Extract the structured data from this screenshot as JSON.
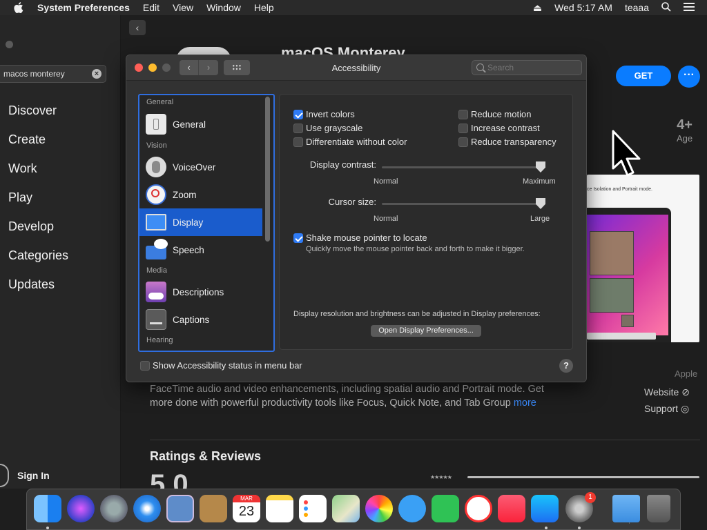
{
  "menubar": {
    "app_name": "System Preferences",
    "items": [
      "Edit",
      "View",
      "Window",
      "Help"
    ],
    "clock": "Wed 5:17 AM",
    "user": "teaaa"
  },
  "store": {
    "search_value": "macos monterey",
    "nav": [
      "Discover",
      "Create",
      "Work",
      "Play",
      "Develop",
      "Categories",
      "Updates"
    ],
    "sign_in": "Sign In",
    "app_title": "macOS Monterey",
    "get_label": "GET",
    "more_label": "···",
    "age_rating": "4+",
    "age_label": "Age",
    "preview_caption": "ce Isolation and Portrait mode.",
    "description_line1": "FaceTime audio and video enhancements, including spatial audio and Portrait mode. Get",
    "description_line2": "more done with powerful productivity tools like Focus, Quick Note, and Tab Group",
    "more_link": "more",
    "developer": "Apple",
    "website": "Website",
    "support": "Support",
    "ratings_title": "Ratings & Reviews",
    "rating_value": "5.0",
    "stars": "★★★★★"
  },
  "window": {
    "title": "Accessibility",
    "search_placeholder": "Search",
    "sidebar": {
      "sections": [
        "General",
        "Vision",
        "Media",
        "Hearing"
      ],
      "items": [
        "General",
        "VoiceOver",
        "Zoom",
        "Display",
        "Speech",
        "Descriptions",
        "Captions"
      ],
      "selected": "Display"
    },
    "options": {
      "invert_colors": "Invert colors",
      "use_grayscale": "Use grayscale",
      "differentiate": "Differentiate without color",
      "reduce_motion": "Reduce motion",
      "increase_contrast": "Increase contrast",
      "reduce_transparency": "Reduce transparency"
    },
    "checked": {
      "invert_colors": true,
      "use_grayscale": false,
      "differentiate": false,
      "reduce_motion": false,
      "increase_contrast": false,
      "reduce_transparency": false,
      "shake": true,
      "status_menu": false
    },
    "display_contrast": {
      "label": "Display contrast:",
      "min": "Normal",
      "max": "Maximum",
      "value": 1.0
    },
    "cursor_size": {
      "label": "Cursor size:",
      "min": "Normal",
      "max": "Large",
      "value": 1.0
    },
    "shake": {
      "label": "Shake mouse pointer to locate",
      "hint": "Quickly move the mouse pointer back and forth to make it bigger."
    },
    "display_note": "Display resolution and brightness can be adjusted in Display preferences:",
    "open_display_button": "Open Display Preferences...",
    "status_menu_label": "Show Accessibility status in menu bar",
    "help": "?"
  },
  "dock": {
    "items": [
      "finder",
      "siri",
      "launchpad",
      "safari",
      "mail",
      "contacts",
      "calendar",
      "notes",
      "reminders",
      "maps",
      "photos",
      "messages",
      "facetime",
      "news",
      "music",
      "app-store",
      "system-preferences",
      "downloads",
      "trash"
    ],
    "calendar_month": "MAR",
    "calendar_day": "23",
    "prefs_badge": "1"
  },
  "colors": {
    "accent": "#2f7bf5",
    "selection": "#1a5ccc",
    "store_blue": "#0a7cff"
  }
}
